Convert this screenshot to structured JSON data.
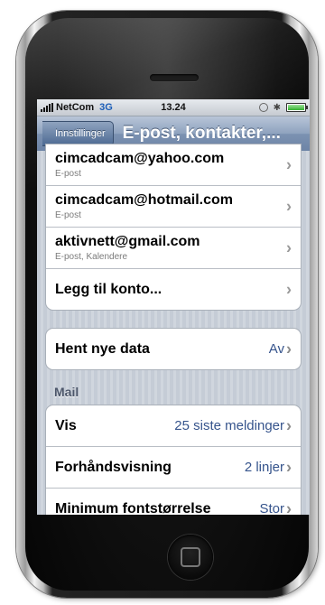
{
  "status_bar": {
    "carrier": "NetCom",
    "network": "3G",
    "time": "13.24"
  },
  "nav": {
    "back_label": "Innstillinger",
    "title": "E-post, kontakter,..."
  },
  "accounts": [
    {
      "title": "cimcadcam@yahoo.com",
      "subtitle": "E-post"
    },
    {
      "title": "cimcadcam@hotmail.com",
      "subtitle": "E-post"
    },
    {
      "title": "aktivnett@gmail.com",
      "subtitle": "E-post, Kalendere"
    }
  ],
  "add_account": "Legg til konto...",
  "fetch": {
    "label": "Hent nye data",
    "value": "Av"
  },
  "mail": {
    "header": "Mail",
    "rows": [
      {
        "label": "Vis",
        "value": "25 siste meldinger"
      },
      {
        "label": "Forhåndsvisning",
        "value": "2 linjer"
      },
      {
        "label": "Minimum fontstørrelse",
        "value": "Stor"
      }
    ]
  },
  "icons": {
    "signal": "signal-bars-icon",
    "lock": "orientation-lock-icon",
    "bluetooth": "bluetooth-icon",
    "battery": "battery-icon",
    "chevron": "chevron-right-icon",
    "home": "home-button-icon"
  },
  "colors": {
    "nav_bar": "#7c92b2",
    "value_text": "#36548c",
    "group_background": "#ffffff",
    "page_background": "#c5ccd6"
  }
}
